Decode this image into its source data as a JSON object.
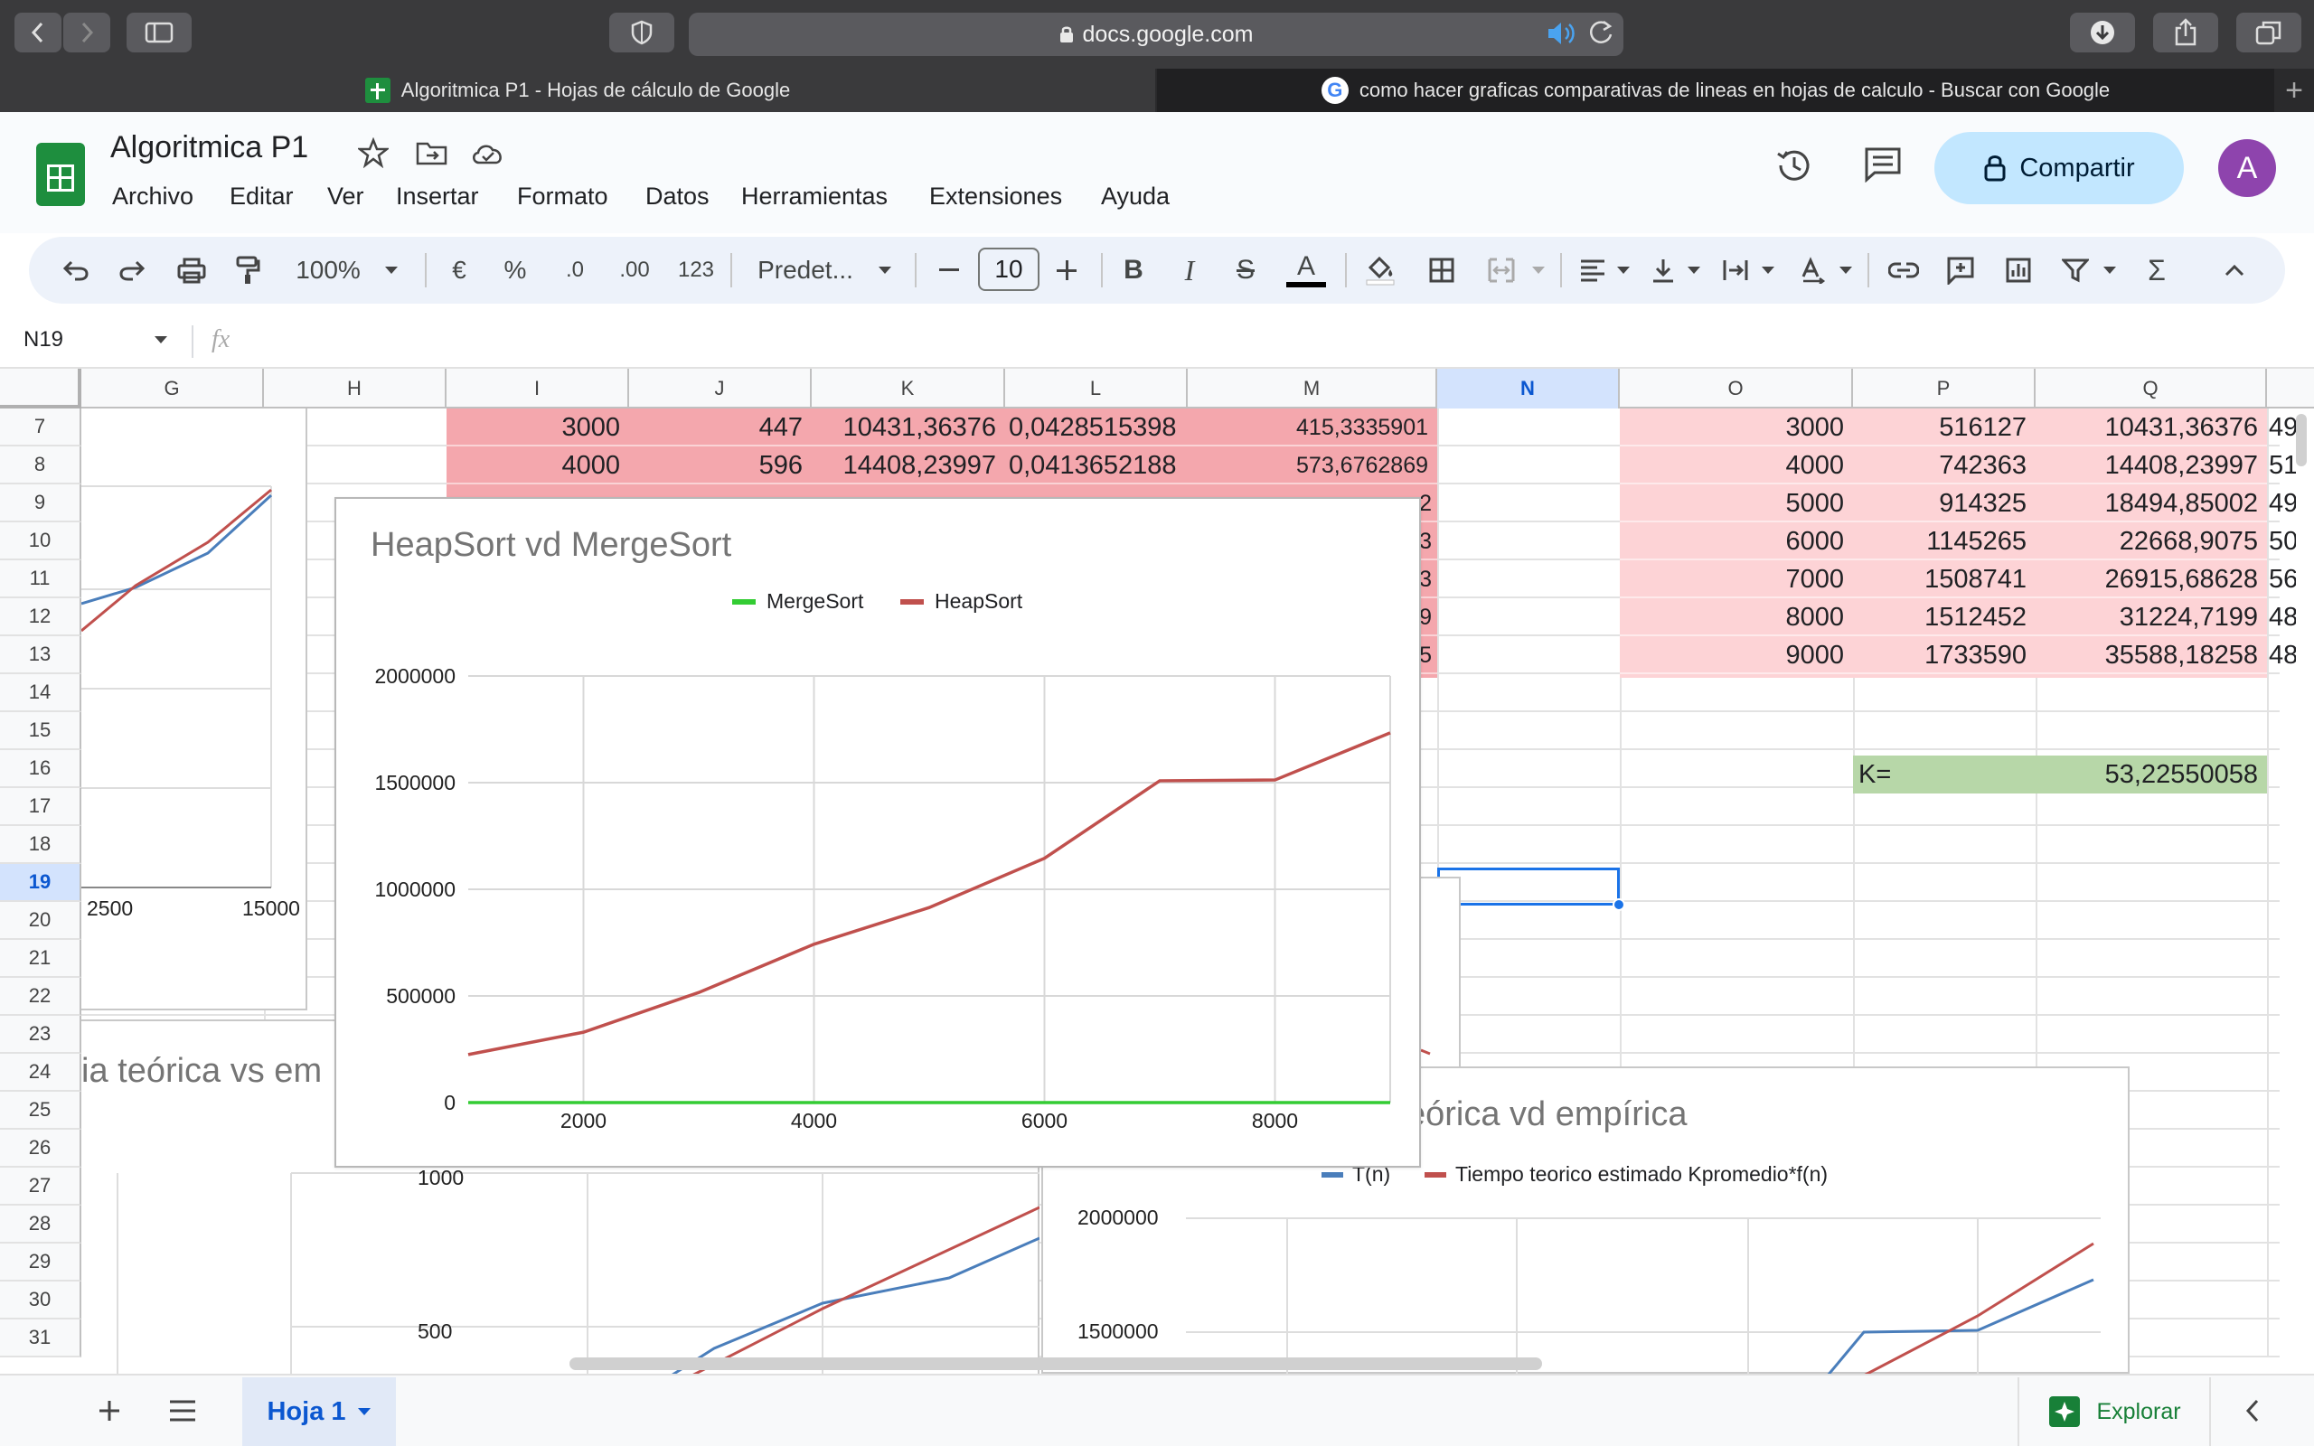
{
  "browser": {
    "url": "docs.google.com",
    "tabs": [
      {
        "label": "Algoritmica P1 - Hojas de cálculo de Google"
      },
      {
        "label": "como hacer graficas comparativas de lineas en hojas de calculo - Buscar con Google"
      }
    ],
    "new_tab": "+"
  },
  "app": {
    "title": "Algoritmica P1",
    "menu": [
      "Archivo",
      "Editar",
      "Ver",
      "Insertar",
      "Formato",
      "Datos",
      "Herramientas",
      "Extensiones",
      "Ayuda"
    ],
    "share_label": "Compartir",
    "avatar_letter": "A",
    "accent": "#0b57d0"
  },
  "toolbar": {
    "zoom": "100%",
    "currency": "€",
    "percent": "%",
    "dec_less": ".0",
    "dec_more": ".00",
    "num_format": "123",
    "font": "Predet...",
    "font_size": "10",
    "bold": "B",
    "italic": "I",
    "strike": "S",
    "text_color": "A",
    "sum": "Σ"
  },
  "formula_bar": {
    "cell_ref": "N19",
    "fx": "fx"
  },
  "grid": {
    "columns": [
      "G",
      "H",
      "I",
      "J",
      "K",
      "L",
      "M",
      "N",
      "O",
      "P",
      "Q"
    ],
    "rows": [
      "7",
      "8",
      "9",
      "10",
      "11",
      "12",
      "13",
      "14",
      "15",
      "16",
      "17",
      "18",
      "19",
      "20",
      "21",
      "22",
      "23",
      "24",
      "25",
      "26",
      "27",
      "28",
      "29",
      "30",
      "31"
    ],
    "active_row": "19",
    "active_col": "N",
    "left_table": [
      {
        "i": "3000",
        "j": "447",
        "k": "10431,36376",
        "l": "0,0428515398",
        "m": "415,3335901"
      },
      {
        "i": "4000",
        "j": "596",
        "k": "14408,23997",
        "l": "0,0413652188",
        "m": "573,6762869"
      }
    ],
    "m_fragments": [
      "2",
      "3",
      "3",
      "9",
      "5"
    ],
    "right_table": [
      {
        "o": "3000",
        "p": "516127",
        "q": "10431,36376",
        "r": "49"
      },
      {
        "o": "4000",
        "p": "742363",
        "q": "14408,23997",
        "r": "51"
      },
      {
        "o": "5000",
        "p": "914325",
        "q": "18494,85002",
        "r": "49"
      },
      {
        "o": "6000",
        "p": "1145265",
        "q": "22668,9075",
        "r": "50"
      },
      {
        "o": "7000",
        "p": "1508741",
        "q": "26915,68628",
        "r": "56"
      },
      {
        "o": "8000",
        "p": "1512452",
        "q": "31224,7199",
        "r": "48"
      },
      {
        "o": "9000",
        "p": "1733590",
        "q": "35588,18258",
        "r": "48"
      }
    ],
    "k_label": "K=",
    "k_value": "53,22550058",
    "colors": {
      "pink_dark": "#f4a7ad",
      "pink_light": "#fdd3d6",
      "green": "#b7d7a8"
    }
  },
  "chart_data": [
    {
      "type": "line",
      "title": "HeapSort vd MergeSort",
      "x": [
        1000,
        2000,
        3000,
        4000,
        5000,
        6000,
        7000,
        8000,
        9000
      ],
      "series": [
        {
          "name": "MergeSort",
          "color": "#33cc33",
          "values": [
            0,
            0,
            0,
            0,
            0,
            0,
            0,
            0,
            0
          ]
        },
        {
          "name": "HeapSort",
          "color": "#c0504d",
          "values": [
            225000,
            330000,
            516127,
            742363,
            914325,
            1145265,
            1508741,
            1512452,
            1733590
          ]
        }
      ],
      "x_ticks": [
        "2000",
        "4000",
        "6000",
        "8000"
      ],
      "y_ticks": [
        "0",
        "500000",
        "1000000",
        "1500000",
        "2000000"
      ],
      "xlim": [
        1000,
        9000
      ],
      "ylim": [
        0,
        2000000
      ],
      "legend": "top",
      "grid": true
    },
    {
      "type": "line",
      "title_fragment": "eórica vd empírica",
      "legend_items": [
        "T(n)",
        "Tiempo teorico estimado Kpromedio*f(n)"
      ],
      "y_ticks": [
        "2000000",
        "1500000"
      ]
    },
    {
      "type": "line",
      "title_fragment": "ia teórica vs em",
      "y_ticks": [
        "1000",
        "500"
      ]
    },
    {
      "type": "line",
      "x_ticks": [
        "2500",
        "15000"
      ]
    }
  ],
  "sheets": {
    "active": "Hoja 1",
    "explore": "Explorar"
  }
}
